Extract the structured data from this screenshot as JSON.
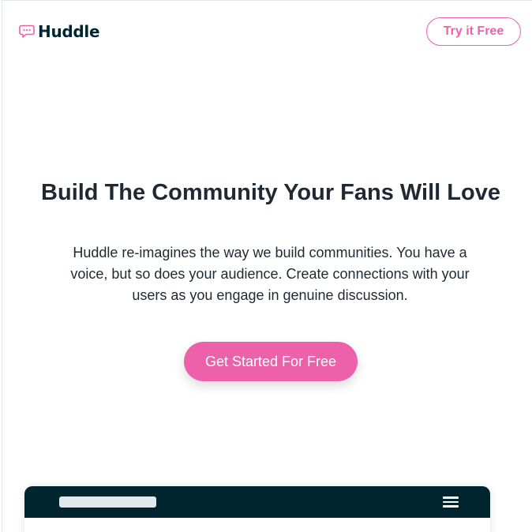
{
  "header": {
    "logo_text": "Huddle",
    "logo_icon": "chat-bubble-icon",
    "try_button_label": "Try it Free"
  },
  "hero": {
    "title": "Build The Community Your Fans Will Love",
    "description": "Huddle re-imagines the way we build communities. You have a voice, but so does your audience. Create connections with your users as you engage in genuine discussion.",
    "cta_label": "Get Started For Free"
  },
  "mockup": {
    "menu_icon": "hamburger-menu-icon"
  },
  "colors": {
    "brand_pink": "#ec61a9",
    "dark_navy": "#00252e",
    "text": "#1f2933",
    "placeholder": "#e3e8ed"
  }
}
